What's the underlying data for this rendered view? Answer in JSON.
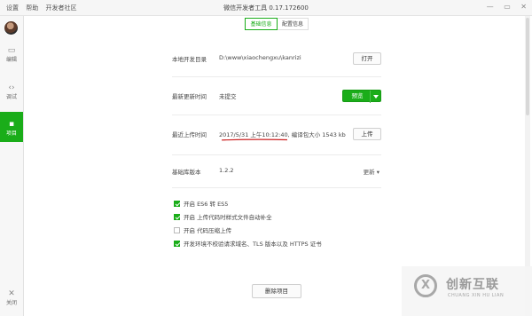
{
  "menu": [
    "设置",
    "帮助",
    "开发者社区"
  ],
  "window_title": "微信开发者工具 0.17.172600",
  "window_controls": [
    "—",
    "▭",
    "✕"
  ],
  "sidebar": {
    "items": [
      {
        "label": "编辑",
        "icon": "edit-icon"
      },
      {
        "label": "调试",
        "icon": "code-icon"
      },
      {
        "label": "项目",
        "icon": "project-icon",
        "active": true
      }
    ],
    "close_label": "关闭"
  },
  "tabs": {
    "basic": "基础信息",
    "config": "配置信息"
  },
  "fields": {
    "dir_label": "本地开发目录",
    "dir_value": "D:\\www\\xiaochengxu\\kanrizi",
    "open_button": "打开",
    "updated_label": "最新更新时间",
    "updated_value": "未提交",
    "preview_button": "预览",
    "upload_label": "最近上传时间",
    "upload_value": "2017/5/31 上午10:12:40, 编译包大小 1543 kb",
    "upload_button": "上传",
    "lib_label": "基础库版本",
    "lib_value": "1.2.2",
    "lib_action": "更新 ▾"
  },
  "options": [
    {
      "label": "开启 ES6 转 ES5",
      "checked": true
    },
    {
      "label": "开启 上传代码时样式文件自动补全",
      "checked": true
    },
    {
      "label": "开启 代码压缩上传",
      "checked": false
    },
    {
      "label": "开发环境不校验请求域名、TLS 版本以及 HTTPS 证书",
      "checked": true
    }
  ],
  "delete_button": "删除项目",
  "watermark": {
    "cn": "创新互联",
    "en": "CHUANG XIN HU LIAN"
  },
  "colors": {
    "accent": "#1aad19",
    "underline": "#cc2222"
  }
}
